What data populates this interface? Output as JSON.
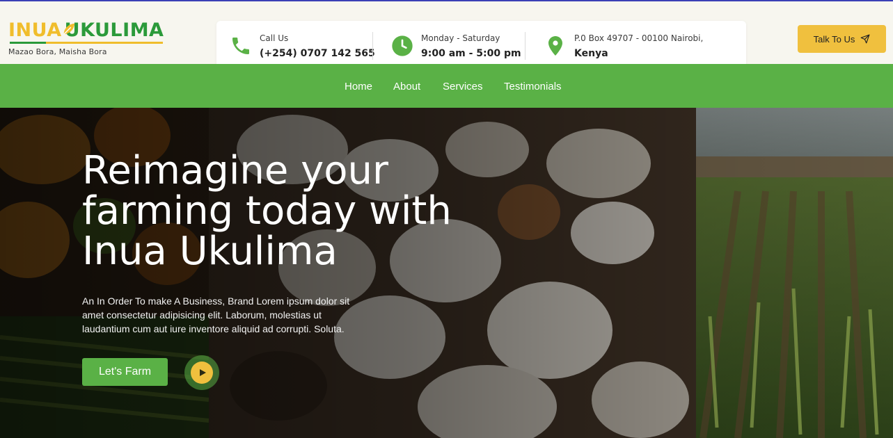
{
  "brand": {
    "name_part1": "INUA",
    "name_part2": "UKULIMA",
    "tagline": "Mazao Bora, Maisha Bora",
    "colors": {
      "yellow": "#f0bd2c",
      "green": "#2b9a3a"
    },
    "icon": "leaf-icon"
  },
  "contact": {
    "call": {
      "label": "Call Us",
      "value": "(+254) 0707 142 565",
      "icon": "phone-icon"
    },
    "hours": {
      "label": "Monday - Saturday",
      "value": "9:00 am - 5:00 pm",
      "icon": "clock-icon"
    },
    "address": {
      "label": "P.0 Box 49707 - 00100 Nairobi,",
      "value": "Kenya",
      "icon": "map-pin-icon"
    }
  },
  "header": {
    "cta_label": "Talk To Us",
    "cta_icon": "send-icon"
  },
  "nav": {
    "items": [
      {
        "label": "Home"
      },
      {
        "label": "About"
      },
      {
        "label": "Services"
      },
      {
        "label": "Testimonials"
      }
    ]
  },
  "hero": {
    "title": "Reimagine your farming today with Inua Ukulima",
    "description": "An In Order To make A Business, Brand Lorem ipsum dolor sit amet consectetur adipisicing elit. Laborum, molestias ut laudantium cum aut iure inventore aliquid ad corrupti. Soluta.",
    "cta_label": "Let's Farm",
    "play_icon": "play-icon"
  },
  "colors": {
    "accent_green": "#5ab146",
    "accent_yellow": "#f0c03e",
    "top_rule": "#3b3fb6"
  }
}
